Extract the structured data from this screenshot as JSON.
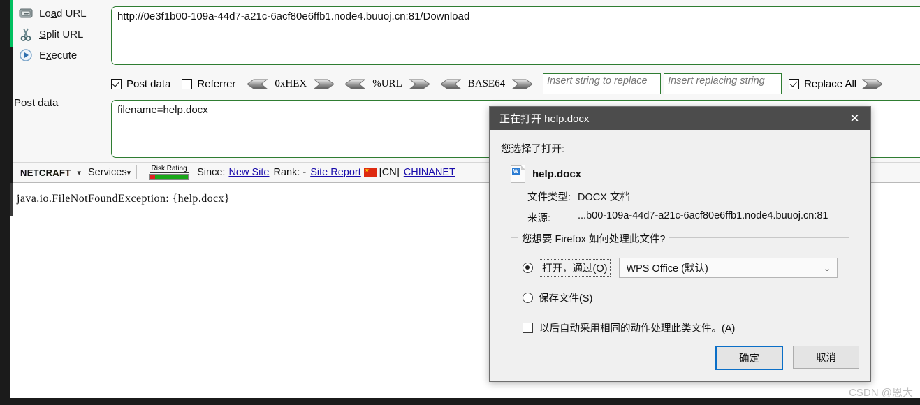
{
  "hackbar": {
    "buttons": [
      {
        "icon": "load-url-icon",
        "label_pre": "Lo",
        "label_key": "a",
        "label_post": "d URL",
        "name": "load-url"
      },
      {
        "icon": "scissors-icon",
        "label_pre": "",
        "label_key": "S",
        "label_post": "plit URL",
        "name": "split-url"
      },
      {
        "icon": "execute-icon",
        "label_pre": "E",
        "label_key": "x",
        "label_post": "ecute",
        "name": "execute"
      }
    ],
    "url_value": "http://0e3f1b00-109a-44d7-a21c-6acf80e6ffb1.node4.buuoj.cn:81/Download",
    "post_data_label": "Post data",
    "post_data_value": "filename=help.docx",
    "checkboxes": [
      {
        "label": "Post data",
        "checked": true
      },
      {
        "label": "Referrer",
        "checked": false
      }
    ],
    "codecs": [
      "0xHEX",
      "%URL",
      "BASE64"
    ],
    "replace_from_placeholder": "Insert string to replace",
    "replace_to_placeholder": "Insert replacing string",
    "replace_all_label": "Replace All",
    "replace_all_checked": true
  },
  "netcraft": {
    "logo_text": "NETCRAFT",
    "dropdown_caret": "▾",
    "services_label": "Services",
    "risk_rating_label": "Risk Rating",
    "risk_red_percent": 12,
    "since_label": "Since:",
    "since_value": "New Site",
    "rank_label": "Rank: -",
    "site_report": "Site Report",
    "country_code": "[CN]",
    "network": "CHINANET"
  },
  "content": {
    "exception_text": "java.io.FileNotFoundException: {help.docx}"
  },
  "dialog": {
    "title": "正在打开 help.docx",
    "close_glyph": "✕",
    "intro": "您选择了打开:",
    "file_name": "help.docx",
    "file_type_key": "文件类型:",
    "file_type_value": "DOCX 文档",
    "source_key": "来源:",
    "source_value": "...b00-109a-44d7-a21c-6acf80e6ffb1.node4.buuoj.cn:81",
    "group_legend": "您想要 Firefox 如何处理此文件?",
    "open_with_label": "打开，通过(O)",
    "open_with_selected": true,
    "app_value": "WPS Office (默认)",
    "app_chevron": "⌄",
    "save_file_label": "保存文件(S)",
    "save_file_selected": false,
    "remember_label": "以后自动采用相同的动作处理此类文件。(A)",
    "remember_checked": false,
    "ok_label": "确定",
    "cancel_label": "取消"
  },
  "watermark": "CSDN @恩大",
  "colors": {
    "accent_green": "#00c060",
    "field_border": "#2f7d32",
    "titlebar": "#4c4c4c",
    "focus_blue": "#0b6fc7",
    "link_blue": "#1a0dab"
  }
}
